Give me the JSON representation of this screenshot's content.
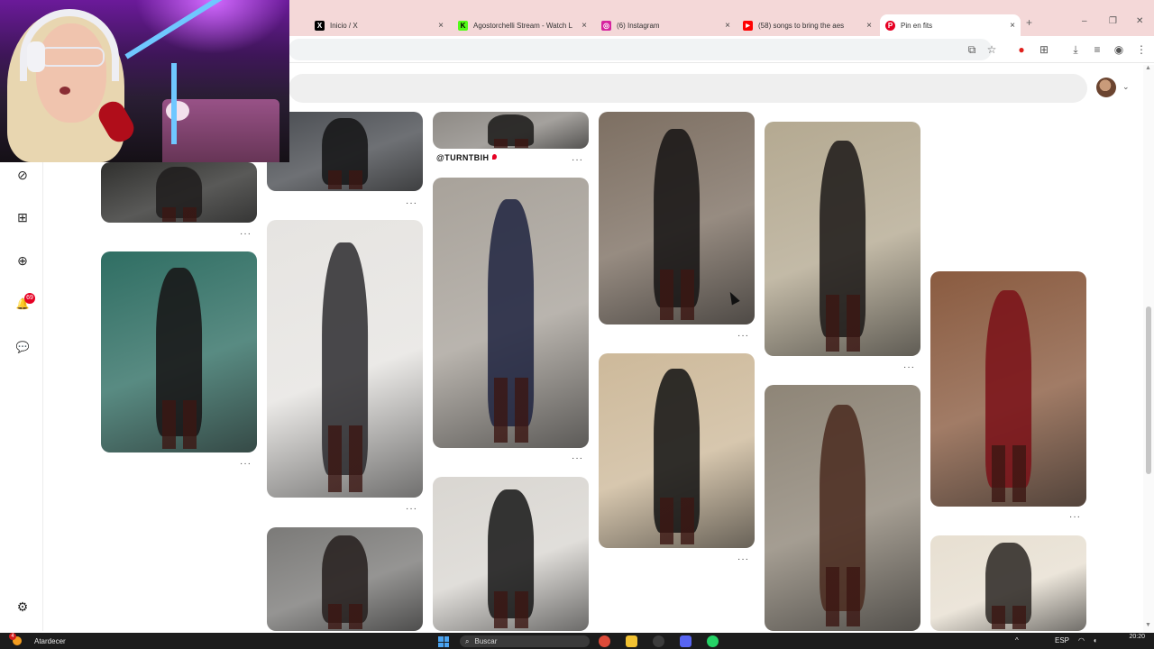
{
  "browser": {
    "tabs": [
      {
        "title": "Inicio / X",
        "icon": "x-logo-icon",
        "color": "#000000",
        "glyph": "X",
        "active": false
      },
      {
        "title": "Agostorchelli Stream - Watch L",
        "icon": "kick-logo-icon",
        "color": "#53fc18",
        "glyph": "K",
        "active": false
      },
      {
        "title": "(6) Instagram",
        "icon": "instagram-logo-icon",
        "color": "#d6249f",
        "glyph": "◎",
        "active": false
      },
      {
        "title": "(58) songs to bring the aes",
        "icon": "youtube-logo-icon",
        "color": "#ff0000",
        "glyph": "▶",
        "active": false
      },
      {
        "title": "Pin en fits",
        "icon": "pinterest-logo-icon",
        "color": "#e60023",
        "glyph": "P",
        "active": true
      }
    ],
    "new_tab_glyph": "+",
    "close_glyph": "×",
    "window_controls": {
      "minimize": "–",
      "maximize": "❐",
      "close": "✕"
    }
  },
  "toolbar_icons": [
    {
      "name": "install-app-icon",
      "glyph": "⧉"
    },
    {
      "name": "bookmark-star-icon",
      "glyph": "☆"
    },
    {
      "name": "extension-red-icon",
      "glyph": "●"
    },
    {
      "name": "extensions-puzzle-icon",
      "glyph": "⊞"
    },
    {
      "name": "download-icon",
      "glyph": "⤓"
    },
    {
      "name": "reading-list-icon",
      "glyph": "≡"
    },
    {
      "name": "profile-icon",
      "glyph": "◉"
    },
    {
      "name": "browser-menu-icon",
      "glyph": "⋮"
    }
  ],
  "pinterest": {
    "sidebar_icons": [
      {
        "name": "explore-compass-icon",
        "glyph": "⊘"
      },
      {
        "name": "boards-icon",
        "glyph": "⊞"
      },
      {
        "name": "create-plus-icon",
        "glyph": "⊕"
      },
      {
        "name": "notifications-bell-icon",
        "glyph": "🔔"
      },
      {
        "name": "messages-icon",
        "glyph": "💬"
      },
      {
        "name": "settings-gear-icon",
        "glyph": "⚙"
      }
    ],
    "notification_count": "69",
    "pin_caption": "@TURNTBIH",
    "more_glyph": "···",
    "avatar_chevron": "⌄",
    "pins": [
      {
        "bg": "#30302e",
        "fig": "#1f1c1c"
      },
      {
        "bg": "#4a4d52",
        "fig": "#141415"
      },
      {
        "bg": "#8e8a85",
        "fig": "#1a1918"
      },
      {
        "bg": "#7d6f62",
        "fig": "#151313"
      },
      {
        "bg": "#b4a991",
        "fig": "#1b1816"
      },
      {
        "bg": "#2f6e63",
        "fig": "#161314"
      },
      {
        "bg": "#e6e4e1",
        "fig": "#2b2a2e"
      },
      {
        "bg": "#a8a29a",
        "fig": "#1e2340"
      },
      {
        "bg": "#cdb99a",
        "fig": "#121212"
      },
      {
        "bg": "#8a5b40",
        "fig": "#7a1018"
      },
      {
        "bg": "#8e8577",
        "fig": "#4a2a1f"
      },
      {
        "bg": "#7b7a78",
        "fig": "#241d1c"
      },
      {
        "bg": "#d9d6d1",
        "fig": "#151515"
      },
      {
        "bg": "#e7dfd1",
        "fig": "#2a2622"
      }
    ]
  },
  "taskbar": {
    "weather_label": "Atardecer",
    "weather_badge": "4",
    "search_placeholder": "Buscar",
    "search_icon": "⌕",
    "apps": [
      {
        "name": "file-explorer-icon",
        "color": "#f2c232"
      },
      {
        "name": "chrome-icon",
        "color": "#dd4b39"
      },
      {
        "name": "obs-icon",
        "color": "#3c3c3c"
      },
      {
        "name": "discord-icon",
        "color": "#5865f2"
      },
      {
        "name": "whatsapp-icon",
        "color": "#25d366"
      }
    ],
    "tray": {
      "chevron": "^",
      "language": "ESP",
      "time": "20:20"
    }
  }
}
